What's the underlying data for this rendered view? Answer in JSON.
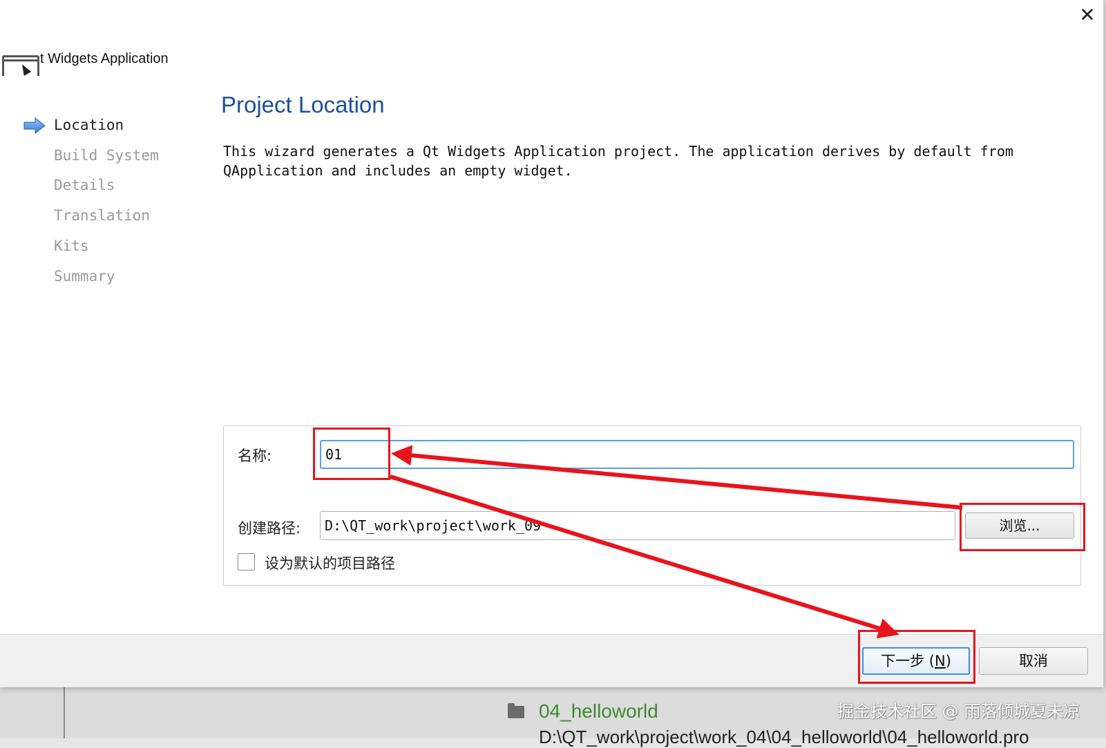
{
  "dialog": {
    "title": "t Widgets Application",
    "close_icon": "close-icon"
  },
  "sidebar": {
    "steps": [
      {
        "label": "Location",
        "active": true
      },
      {
        "label": "Build System",
        "active": false
      },
      {
        "label": "Details",
        "active": false
      },
      {
        "label": "Translation",
        "active": false
      },
      {
        "label": "Kits",
        "active": false
      },
      {
        "label": "Summary",
        "active": false
      }
    ]
  },
  "main": {
    "heading": "Project Location",
    "description": "This wizard generates a Qt Widgets Application project. The application derives by default from QApplication and includes an empty widget.",
    "form": {
      "name_label": "名称:",
      "name_value": "01",
      "path_label": "创建路径:",
      "path_value": "D:\\QT_work\\project\\work_09",
      "browse_label": "浏览...",
      "default_path_label": "设为默认的项目路径",
      "default_path_checked": false
    }
  },
  "footer": {
    "next_label_prefix": "下一步 (",
    "next_mnemonic": "N",
    "next_label_suffix": ")",
    "cancel_label": "取消"
  },
  "background": {
    "folder_name": "04_helloworld",
    "path_text": "D:\\QT_work\\project\\work_04\\04_helloworld\\04_helloworld.pro",
    "watermark": "掘金技术社区 @ 雨落倾城夏未凉"
  },
  "colors": {
    "heading": "#1c4f9c",
    "annotation": "#e8141c",
    "input_focus": "#5aa0e8",
    "folder_text": "#3c8a2e"
  }
}
